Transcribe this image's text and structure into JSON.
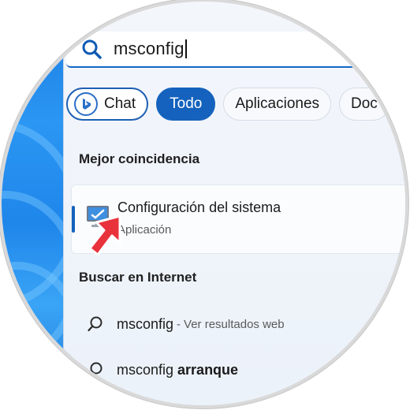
{
  "search": {
    "query": "msconfig"
  },
  "filters": [
    {
      "label": "Chat"
    },
    {
      "label": "Todo"
    },
    {
      "label": "Aplicaciones"
    },
    {
      "label": "Doc"
    }
  ],
  "best_match": {
    "heading": "Mejor coincidencia",
    "app_name": "Configuración del sistema",
    "app_type": "Aplicación"
  },
  "web": {
    "heading": "Buscar en Internet",
    "results": [
      {
        "query": "msconfig",
        "separator": " - ",
        "hint": "Ver resultados web"
      },
      {
        "query_prefix": "msconfig ",
        "query_bold": "arranque"
      }
    ]
  },
  "colors": {
    "accent": "#1462bd",
    "pointer": "#e8333d",
    "wallpaper": "#2b96f3"
  },
  "icons": [
    "search-icon",
    "bing-chat-icon",
    "system-configuration-icon",
    "red-pointer-arrow-icon"
  ]
}
